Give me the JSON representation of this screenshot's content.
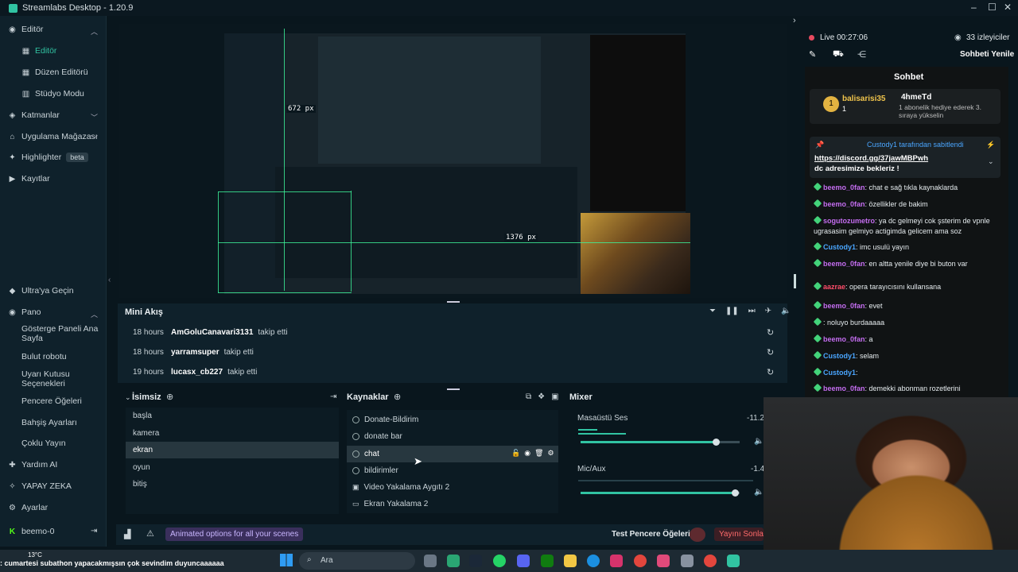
{
  "app": {
    "title": "Streamlabs Desktop - 1.20.9"
  },
  "sidebar": {
    "editor_group": "Editör",
    "editor": "Editör",
    "layout_editor": "Düzen Editörü",
    "studio_mode": "Stüdyo Modu",
    "layers": "Katmanlar",
    "app_store": "Uygulama Mağazası",
    "highlighter": "Highlighter",
    "beta": "beta",
    "recordings": "Kayıtlar",
    "ultra": "Ultra'ya Geçin",
    "pano": "Pano",
    "dashboard": "Gösterge Paneli Ana Sayfa",
    "cloudbot": "Bulut robotu",
    "alertbox": "Uyarı Kutusu Seçenekleri",
    "widgets": "Pencere Öğeleri",
    "tip_settings": "Bahşiş Ayarları",
    "multistream": "Çoklu Yayın",
    "help_ai": "Yardım AI",
    "ai": "YAPAY ZEKA",
    "settings": "Ayarlar",
    "user": "beemo-0"
  },
  "preview": {
    "measure_left": "672 px",
    "measure_right": "1376 px"
  },
  "mini_feed": {
    "title": "Mini Akış",
    "rows": [
      {
        "time": "18 hours",
        "user": "AmGoluCanavari3131",
        "action": "takip etti"
      },
      {
        "time": "18 hours",
        "user": "yarramsuper",
        "action": "takip etti"
      },
      {
        "time": "19 hours",
        "user": "lucasx_cb227",
        "action": "takip etti"
      }
    ]
  },
  "scenes": {
    "title": "İsimsiz",
    "items": [
      "başla",
      "kamera",
      "ekran",
      "oyun",
      "bitiş"
    ],
    "selected": "ekran"
  },
  "sources": {
    "title": "Kaynaklar",
    "items": [
      "Donate-Bildirim",
      "donate bar",
      "chat",
      "bildirimler",
      "Video Yakalama Aygıtı 2",
      "Ekran Yakalama 2"
    ],
    "selected": "chat"
  },
  "mixer": {
    "title": "Mixer",
    "channels": [
      {
        "name": "Masaüstü Ses",
        "db": "-11.2",
        "level": 0.85
      },
      {
        "name": "Mic/Aux",
        "db": "-1.4",
        "level": 0.97
      }
    ]
  },
  "bottombar": {
    "promo": "Animated options for all your scenes",
    "test_widgets": "Test Pencere Öğeleri",
    "end_stream": "Yayını Sonla"
  },
  "live": {
    "status": "Live 00:27:06",
    "viewers": "33 izleyiciler",
    "refresh": "Sohbeti Yenile",
    "chat_title": "Sohbet"
  },
  "pinned": {
    "user": "balisarisi35",
    "count": "1",
    "gifter": "4hmeTd",
    "gift_text": "1 abonelik hediye ederek 3. sıraya yükselin",
    "banner": "Custody1 tarafından sabitlendi",
    "link": "https://discord.gg/37jawMBPwh",
    "link_suffix": "dc adresimize bekleriz !"
  },
  "chat": [
    {
      "user": "beemo_0fan",
      "text": "chat e sağ tıkla kaynaklarda",
      "color": "#c46df0"
    },
    {
      "user": "beemo_0fan",
      "text": "özellikler de bakim",
      "color": "#c46df0"
    },
    {
      "user": "sogutozumetro",
      "text": "ya dc gelmeyi cok şsterim de vpnle ugrasasim gelmiyo actigimda gelicem ama soz",
      "color": "#c46df0"
    },
    {
      "user": "Custody1",
      "text": "imc usulü yayın",
      "color": "#4aa6ff"
    },
    {
      "user": "beemo_0fan",
      "text": "en altta yenile diye bi buton var",
      "color": "#c46df0"
    },
    {
      "user": "aazrae",
      "text": "opera tarayıcısını kullansana",
      "color": "#ff4d6a"
    },
    {
      "user": "beemo_0fan",
      "text": "evet",
      "color": "#c46df0"
    },
    {
      "user": "",
      "text": "noluyo burdaaaaa",
      "color": "#e0324b"
    },
    {
      "user": "beemo_0fan",
      "text": "a",
      "color": "#c46df0"
    },
    {
      "user": "Custody1",
      "text": "selam",
      "color": "#4aa6ff"
    },
    {
      "user": "Custody1",
      "text": "",
      "color": "#4aa6ff"
    },
    {
      "user": "beemo_0fan",
      "text": "demekki abonman rozetlerini",
      "color": "#c46df0"
    }
  ],
  "ticker": {
    "temp": "13°C",
    "text": ": cumartesi subathon yapacakmışsın çok sevindim duyuncaaaaaa"
  },
  "taskbar": {
    "search": "Ara"
  }
}
